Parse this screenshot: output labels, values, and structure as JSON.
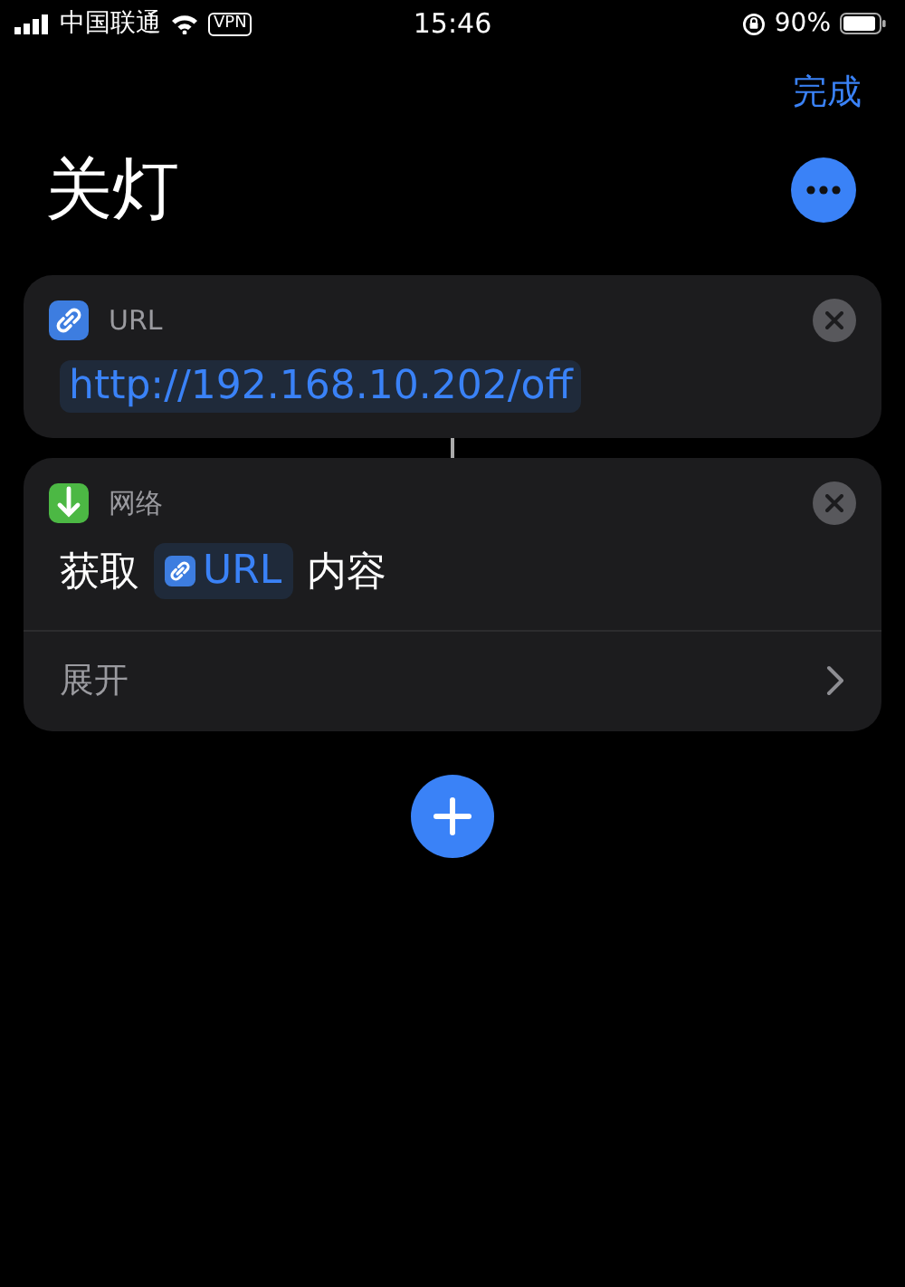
{
  "status_bar": {
    "carrier": "中国联通",
    "vpn": "VPN",
    "time": "15:46",
    "battery": "90%"
  },
  "nav": {
    "done": "完成"
  },
  "title": "关灯",
  "actions": [
    {
      "kind": "url",
      "category": "URL",
      "value": "http://192.168.10.202/off"
    },
    {
      "kind": "fetch",
      "category": "网络",
      "verb": "获取",
      "token": "URL",
      "suffix": "内容",
      "expand": "展开"
    }
  ]
}
